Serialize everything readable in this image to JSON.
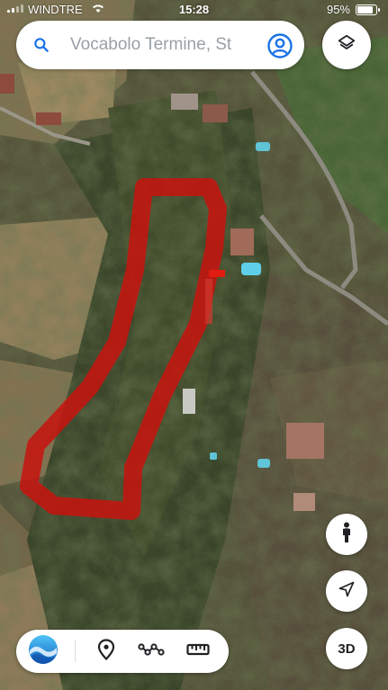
{
  "status_bar": {
    "carrier": "WINDTRE",
    "time": "15:28",
    "battery_percent": "95%",
    "battery_level": 0.95
  },
  "search": {
    "placeholder": "Vocabolo Termine, St"
  },
  "map": {
    "type": "satellite",
    "annotation_color": "#c8130e"
  },
  "buttons": {
    "threed_label": "3D"
  },
  "icons": {
    "search": "search-icon",
    "account": "account-circle-icon",
    "layers": "layers-icon",
    "pegman": "pegman-icon",
    "locate": "navigation-arrow-icon",
    "earth": "earth-voyager-icon",
    "place": "place-pin-icon",
    "path": "path-draw-icon",
    "ruler": "ruler-icon"
  },
  "colors": {
    "accent": "#1a73e8",
    "icon_dark": "#202124"
  }
}
